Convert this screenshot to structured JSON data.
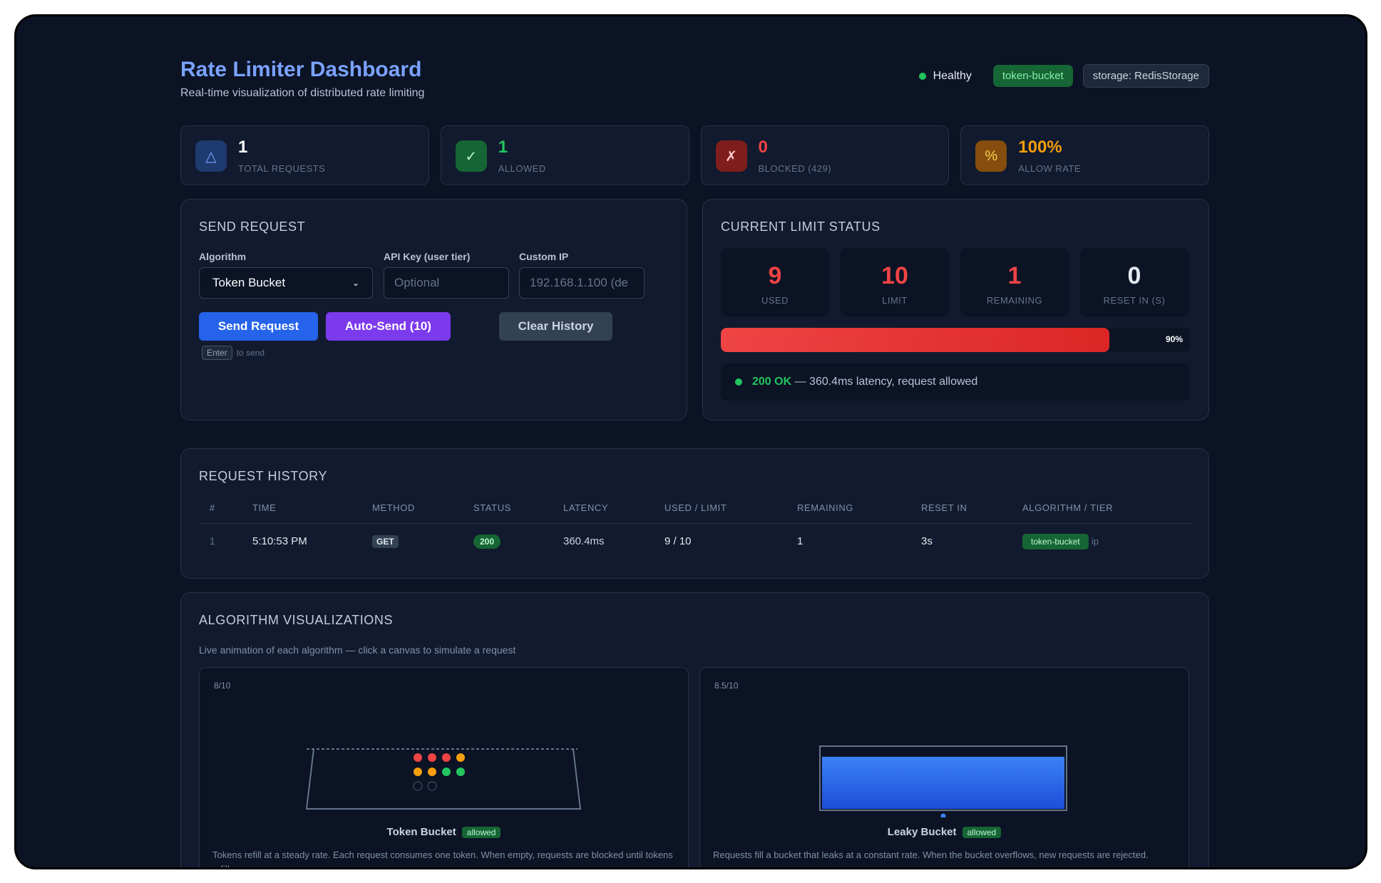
{
  "header": {
    "title": "Rate Limiter Dashboard",
    "subtitle": "Real-time visualization of distributed rate limiting",
    "health": "Healthy",
    "algorithm_badge": "token-bucket",
    "storage_badge": "storage: RedisStorage"
  },
  "stats": [
    {
      "icon": "△",
      "value": "1",
      "label": "TOTAL REQUESTS",
      "color": "#ffffff"
    },
    {
      "icon": "✓",
      "value": "1",
      "label": "ALLOWED",
      "color": "#22c55e"
    },
    {
      "icon": "✗",
      "value": "0",
      "label": "BLOCKED (429)",
      "color": "#ef4444"
    },
    {
      "icon": "%",
      "value": "100%",
      "label": "ALLOW RATE",
      "color": "#f59e0b"
    }
  ],
  "send_request": {
    "title": "SEND REQUEST",
    "algorithm_label": "Algorithm",
    "algorithm_value": "Token Bucket",
    "api_key_label": "API Key (user tier)",
    "api_key_placeholder": "Optional",
    "custom_ip_label": "Custom IP",
    "custom_ip_placeholder": "192.168.1.100 (de",
    "send_button": "Send Request",
    "auto_send_button": "Auto-Send (10)",
    "clear_button": "Clear History",
    "hint_key": "Enter",
    "hint_text": "to send"
  },
  "limit_status": {
    "title": "CURRENT LIMIT STATUS",
    "used": "9",
    "used_label": "USED",
    "limit": "10",
    "limit_label": "LIMIT",
    "remaining": "1",
    "remaining_label": "REMAINING",
    "reset": "0",
    "reset_label": "RESET IN (S)",
    "usage_fraction": 0.9,
    "usage_pct": "90%",
    "response_code": "200 OK",
    "response_text": "— 360.4ms latency, request allowed"
  },
  "history": {
    "title": "REQUEST HISTORY",
    "columns": [
      "#",
      "TIME",
      "METHOD",
      "STATUS",
      "LATENCY",
      "USED / LIMIT",
      "REMAINING",
      "RESET IN",
      "ALGORITHM / TIER"
    ],
    "rows": [
      {
        "num": "1",
        "time": "5:10:53 PM",
        "method": "GET",
        "status": "200",
        "latency": "360.4ms",
        "used_limit": "9 / 10",
        "remaining": "1",
        "reset": "3s",
        "algorithm": "token-bucket",
        "tier": "ip"
      }
    ]
  },
  "visualizations": {
    "title": "ALGORITHM VISUALIZATIONS",
    "subtitle": "Live animation of each algorithm — click a canvas to simulate a request",
    "token_bucket": {
      "count": "8/10",
      "name": "Token Bucket",
      "state": "allowed",
      "description": "Tokens refill at a steady rate. Each request consumes one token. When empty, requests are blocked until tokens refill."
    },
    "leaky_bucket": {
      "count": "8.5/10",
      "name": "Leaky Bucket",
      "state": "allowed",
      "description": "Requests fill a bucket that leaks at a constant rate. When the bucket overflows, new requests are rejected.",
      "fill_fraction": 0.85
    }
  }
}
